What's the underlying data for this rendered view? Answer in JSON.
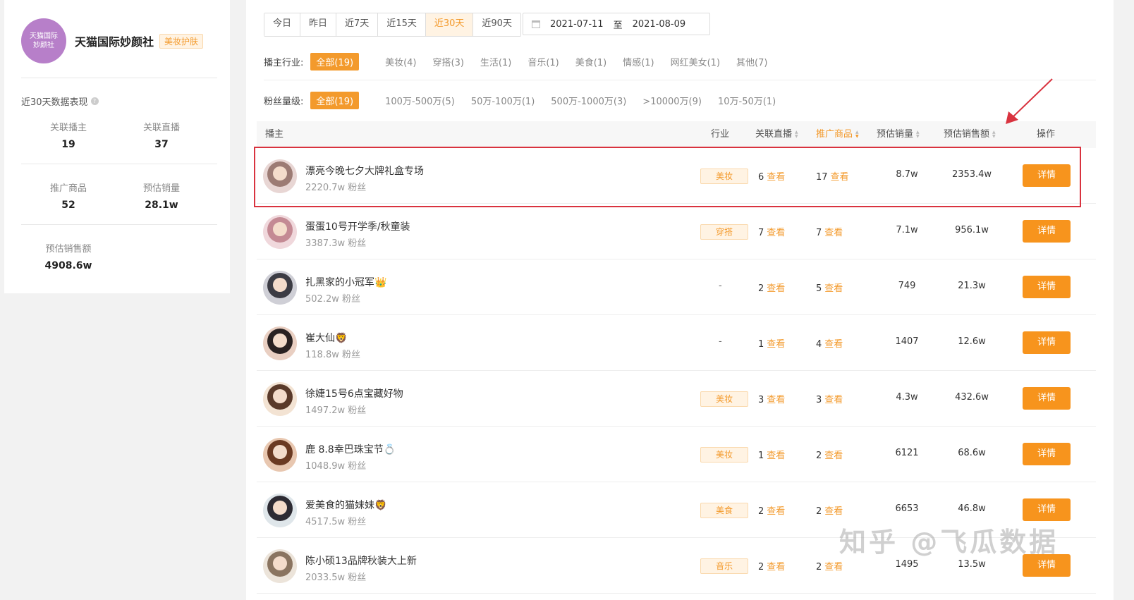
{
  "brand": {
    "logo_line1": "天猫国际",
    "logo_line2": "妙颜社",
    "name": "天猫国际妙颜社",
    "tag": "美妆护肤"
  },
  "stats": {
    "title": "近30天数据表现",
    "items": [
      {
        "label": "关联播主",
        "value": "19"
      },
      {
        "label": "关联直播",
        "value": "37"
      },
      {
        "label": "推广商品",
        "value": "52"
      },
      {
        "label": "预估销量",
        "value": "28.1w"
      },
      {
        "label": "预估销售额",
        "value": "4908.6w"
      }
    ]
  },
  "date_tabs": [
    "今日",
    "昨日",
    "近7天",
    "近15天",
    "近30天",
    "近90天"
  ],
  "date_tab_active": "近30天",
  "date_range": {
    "start": "2021-07-11",
    "sep": "至",
    "end": "2021-08-09"
  },
  "filters": {
    "industry": {
      "label": "播主行业:",
      "items": [
        "全部(19)",
        "美妆(4)",
        "穿搭(3)",
        "生活(1)",
        "音乐(1)",
        "美食(1)",
        "情感(1)",
        "网红美女(1)",
        "其他(7)"
      ]
    },
    "fans": {
      "label": "粉丝量级:",
      "items": [
        "全部(19)",
        "100万-500万(5)",
        "50万-100万(1)",
        "500万-1000万(3)",
        ">10000万(9)",
        "10万-50万(1)"
      ]
    }
  },
  "table": {
    "headers": {
      "streamer": "播主",
      "industry": "行业",
      "live": "关联直播",
      "goods": "推广商品",
      "sales": "预估销量",
      "revenue": "预估销售额",
      "action": "操作"
    },
    "view_label": "查看",
    "detail_label": "详情",
    "rows": [
      {
        "name": "漂亮今晚七夕大牌礼盒专场",
        "fans": "2220.7w 粉丝",
        "industry": "美妆",
        "live": "6",
        "goods": "17",
        "sales": "8.7w",
        "revenue": "2353.4w"
      },
      {
        "name": "蛋蛋10号开学季/秋童装",
        "fans": "3387.3w 粉丝",
        "industry": "穿搭",
        "live": "7",
        "goods": "7",
        "sales": "7.1w",
        "revenue": "956.1w"
      },
      {
        "name": "扎黑家的小冠军👑",
        "fans": "502.2w 粉丝",
        "industry": "-",
        "live": "2",
        "goods": "5",
        "sales": "749",
        "revenue": "21.3w"
      },
      {
        "name": "崔大仙🦁",
        "fans": "118.8w 粉丝",
        "industry": "-",
        "live": "1",
        "goods": "4",
        "sales": "1407",
        "revenue": "12.6w"
      },
      {
        "name": "徐婕15号6点宝藏好物",
        "fans": "1497.2w 粉丝",
        "industry": "美妆",
        "live": "3",
        "goods": "3",
        "sales": "4.3w",
        "revenue": "432.6w"
      },
      {
        "name": "鹿 8.8幸巴珠宝节💍",
        "fans": "1048.9w 粉丝",
        "industry": "美妆",
        "live": "1",
        "goods": "2",
        "sales": "6121",
        "revenue": "68.6w"
      },
      {
        "name": "爱美食的猫妹妹🦁",
        "fans": "4517.5w 粉丝",
        "industry": "美食",
        "live": "2",
        "goods": "2",
        "sales": "6653",
        "revenue": "46.8w"
      },
      {
        "name": "陈小硕13品牌秋装大上新",
        "fans": "2033.5w 粉丝",
        "industry": "音乐",
        "live": "2",
        "goods": "2",
        "sales": "1495",
        "revenue": "13.5w"
      }
    ]
  },
  "watermark": "知乎 @飞瓜数据",
  "colors": {
    "accent": "#f39a2c",
    "button": "#f7941d",
    "highlight": "#d9333f"
  }
}
